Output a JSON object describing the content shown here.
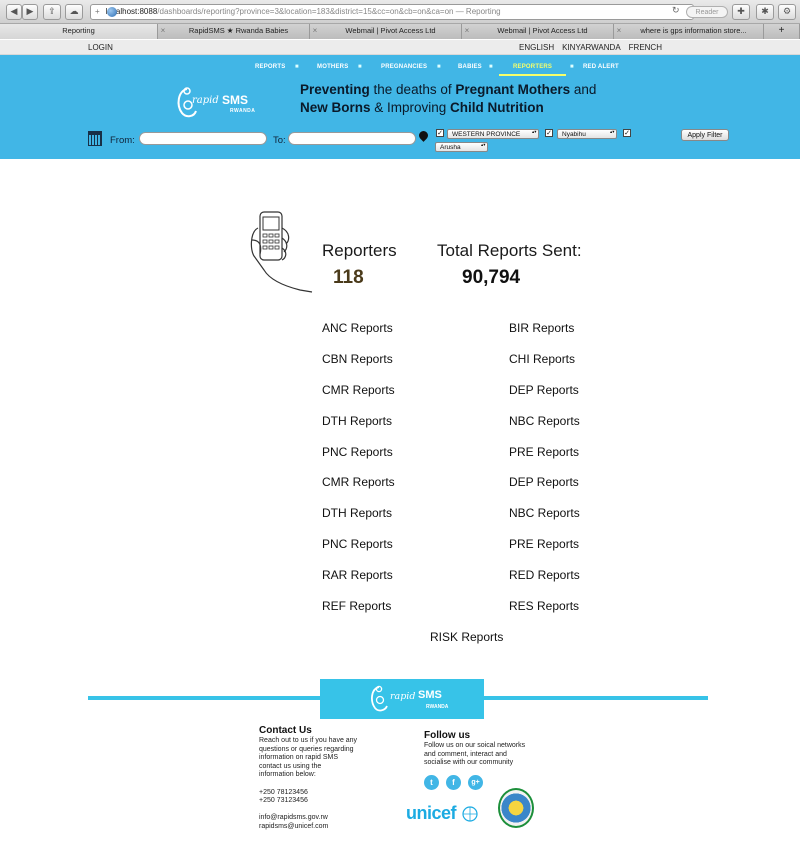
{
  "browser": {
    "url_host": "localhost:8088",
    "url_path": "/dashboards/reporting?province=3&location=183&district=15&cc=on&cb=on&ca=on",
    "url_suffix": " — Reporting",
    "reader_label": "Reader",
    "tabs": [
      {
        "label": "Reporting"
      },
      {
        "label": "RapidSMS ★ Rwanda Babies"
      },
      {
        "label": "Webmail | Pivot Access Ltd"
      },
      {
        "label": "Webmail | Pivot Access Ltd"
      },
      {
        "label": "where is gps information store..."
      }
    ]
  },
  "topbar": {
    "login": "LOGIN",
    "languages": [
      "ENGLISH",
      "KINYARWANDA",
      "FRENCH"
    ]
  },
  "nav": {
    "items": [
      "REPORTS",
      "MOTHERS",
      "PREGNANCIES",
      "BABIES",
      "REPORTERS",
      "RED ALERT"
    ],
    "active": "REPORTERS"
  },
  "logo": {
    "rapid": "rapid",
    "sms": "SMS",
    "country": "RWANDA"
  },
  "tagline": {
    "p1": "Preventing",
    "p2": " the deaths of ",
    "p3": "Pregnant Mothers",
    "p4": " and",
    "p5": "New Borns",
    "p6": " & Improving ",
    "p7": "Child Nutrition"
  },
  "filter": {
    "from_label": "From:",
    "to_label": "To:",
    "from_value": "",
    "to_value": "",
    "province": "WESTERN PROVINCE",
    "district": "Nyabihu",
    "sector": "Arusha",
    "apply_label": "Apply Filter"
  },
  "stats": {
    "reporters_label": "Reporters",
    "reporters_value": "118",
    "total_label": "Total Reports Sent:",
    "total_value": "90,794"
  },
  "reports": {
    "left": [
      "ANC Reports",
      "CBN Reports",
      "CMR Reports",
      "DTH Reports",
      "PNC Reports",
      "CMR Reports",
      "DTH Reports",
      "PNC Reports",
      "RAR Reports",
      "REF Reports"
    ],
    "right": [
      "BIR Reports",
      "CHI Reports",
      "DEP Reports",
      "NBC Reports",
      "PRE Reports",
      "DEP Reports",
      "NBC Reports",
      "PRE Reports",
      "RED Reports",
      "RES Reports"
    ],
    "center": "RISK Reports"
  },
  "footer": {
    "contact_title": "Contact Us",
    "contact_text": [
      "Reach out to us if you have any",
      "questions or queries regarding",
      "information on rapid SMS",
      "contact us using the",
      "information below:"
    ],
    "phones": [
      "+250 78123456",
      "+250 73123456"
    ],
    "emails": [
      "info@rapidsms.gov.rw",
      "rapidsms@unicef.com"
    ],
    "follow_title": "Follow us",
    "follow_text": [
      "Follow us on our soical networks",
      "and comment, interact and",
      "socialise with our community"
    ],
    "social_icons": [
      "twitter-icon",
      "facebook-icon",
      "google-plus-icon"
    ],
    "partner_logo": "unicef"
  },
  "colors": {
    "hero": "#41b6e6",
    "nav_active": "#f7ff6a",
    "reporters_value": "#4a3a1a",
    "footer_bar": "#37c3e8"
  }
}
